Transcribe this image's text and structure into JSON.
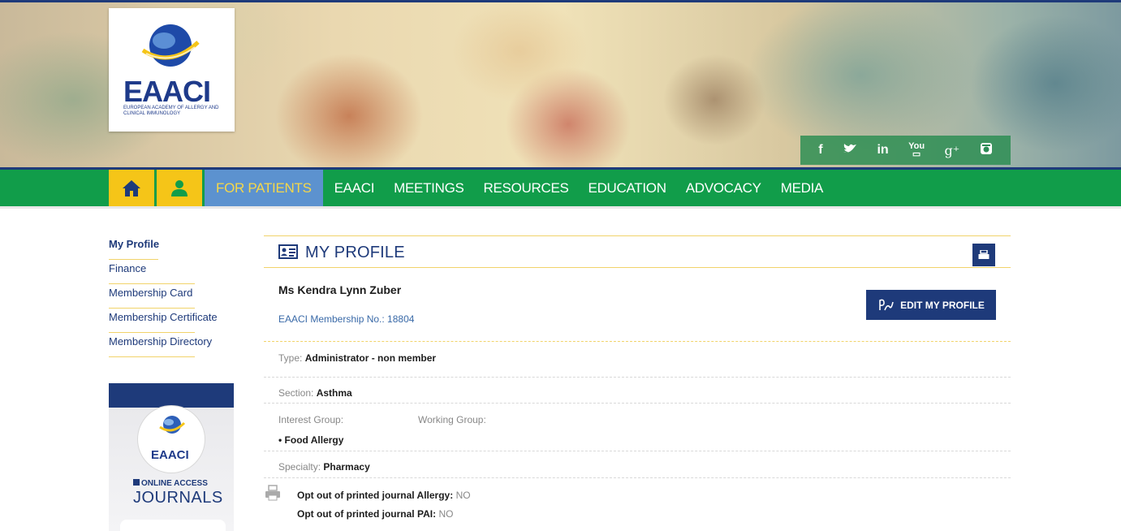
{
  "header": {
    "logo_word": "EAACI",
    "logo_sub": "European Academy of Allergy and Clinical Immunology",
    "social": [
      "f",
      "twitter-icon",
      "in",
      "youtube-icon",
      "g+",
      "instagram-icon"
    ]
  },
  "nav": {
    "items": [
      "FOR PATIENTS",
      "EAACI",
      "MEETINGS",
      "RESOURCES",
      "EDUCATION",
      "ADVOCACY",
      "MEDIA"
    ],
    "active": "FOR PATIENTS"
  },
  "sidebar": {
    "items": [
      "My Profile",
      "Finance",
      "Membership Card",
      "Membership Certificate",
      "Membership Directory"
    ],
    "journal": {
      "brand": "EAACI",
      "online_access": "ONLINE ACCESS",
      "title": "JOURNALS"
    }
  },
  "profile": {
    "title": "MY PROFILE",
    "name": "Ms Kendra Lynn Zuber",
    "membership_no": "EAACI Membership No.: 18804",
    "edit_label": "EDIT MY PROFILE",
    "type_label": "Type:",
    "type_value": "Administrator - non member",
    "section_label": "Section:",
    "section_value": "Asthma",
    "interest_label": "Interest Group:",
    "working_label": "Working Group:",
    "interest_value": "• Food Allergy",
    "specialty_label": "Specialty:",
    "specialty_value": "Pharmacy",
    "optout_allergy_label": "Opt out of printed journal Allergy:",
    "optout_allergy_value": "NO",
    "optout_pai_label": "Opt out of printed journal PAI:",
    "optout_pai_value": "NO"
  },
  "colors": {
    "navy": "#1e3a7a",
    "green": "#119d4a",
    "yellow": "#f5c518",
    "active_blue": "#5c92cf"
  }
}
